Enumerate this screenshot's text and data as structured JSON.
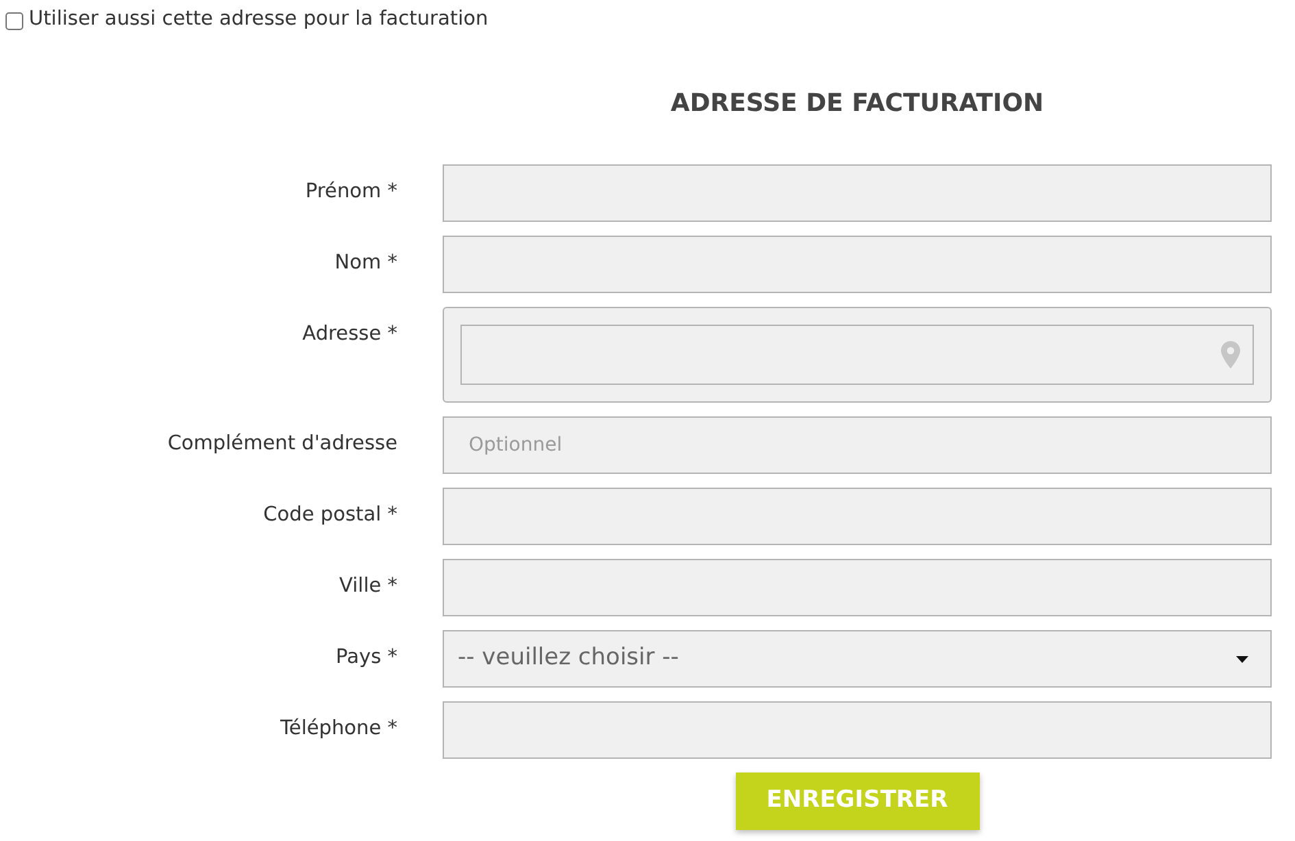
{
  "billing_checkbox": {
    "label": "Utiliser aussi cette adresse pour la facturation",
    "checked": false
  },
  "section_title": "ADRESSE DE FACTURATION",
  "fields": [
    {
      "kind": "text",
      "label": "Prénom *"
    },
    {
      "kind": "text",
      "label": "Nom *"
    },
    {
      "kind": "address",
      "label": "Adresse *"
    },
    {
      "kind": "text",
      "label": "Complément d'adresse",
      "placeholder": "Optionnel"
    },
    {
      "kind": "text",
      "label": "Code postal *"
    },
    {
      "kind": "text",
      "label": "Ville *"
    },
    {
      "kind": "select",
      "label": "Pays *",
      "value": "-- veuillez choisir --"
    },
    {
      "kind": "text",
      "label": "Téléphone *"
    }
  ],
  "submit_button": "ENREGISTRER"
}
